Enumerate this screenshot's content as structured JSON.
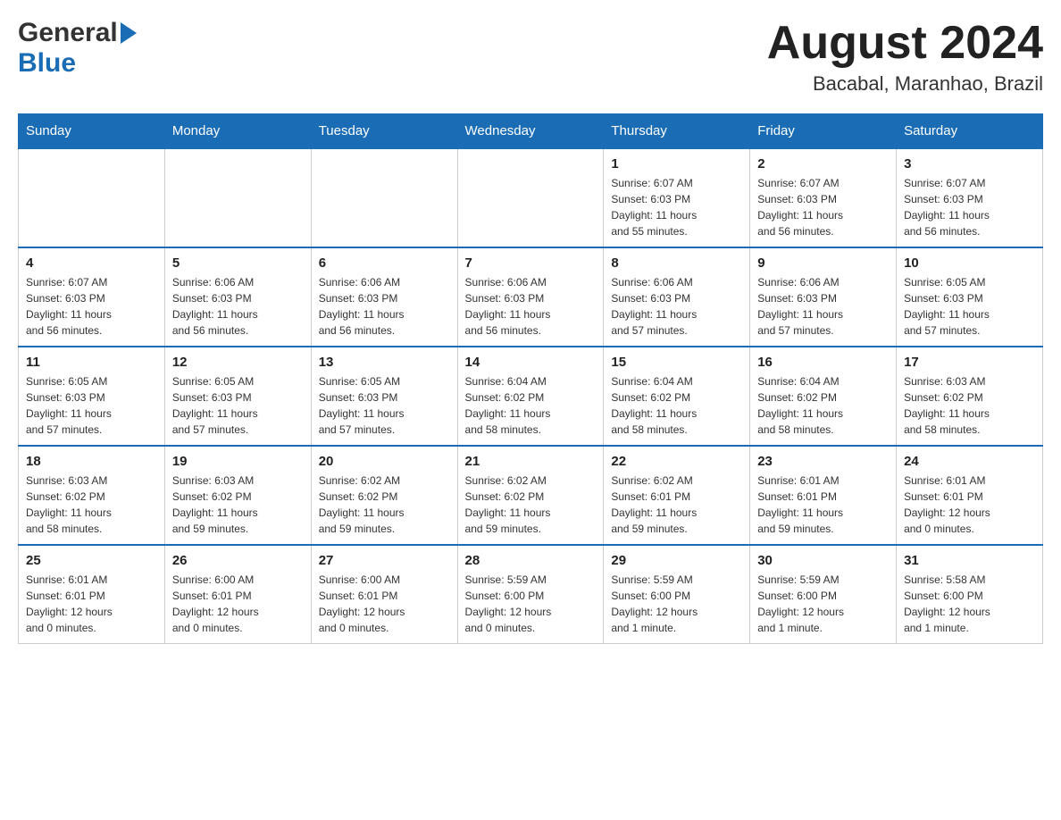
{
  "header": {
    "logo_general": "General",
    "logo_blue": "Blue",
    "month_title": "August 2024",
    "location": "Bacabal, Maranhao, Brazil"
  },
  "days_of_week": [
    "Sunday",
    "Monday",
    "Tuesday",
    "Wednesday",
    "Thursday",
    "Friday",
    "Saturday"
  ],
  "weeks": [
    [
      {
        "day": "",
        "info": ""
      },
      {
        "day": "",
        "info": ""
      },
      {
        "day": "",
        "info": ""
      },
      {
        "day": "",
        "info": ""
      },
      {
        "day": "1",
        "info": "Sunrise: 6:07 AM\nSunset: 6:03 PM\nDaylight: 11 hours\nand 55 minutes."
      },
      {
        "day": "2",
        "info": "Sunrise: 6:07 AM\nSunset: 6:03 PM\nDaylight: 11 hours\nand 56 minutes."
      },
      {
        "day": "3",
        "info": "Sunrise: 6:07 AM\nSunset: 6:03 PM\nDaylight: 11 hours\nand 56 minutes."
      }
    ],
    [
      {
        "day": "4",
        "info": "Sunrise: 6:07 AM\nSunset: 6:03 PM\nDaylight: 11 hours\nand 56 minutes."
      },
      {
        "day": "5",
        "info": "Sunrise: 6:06 AM\nSunset: 6:03 PM\nDaylight: 11 hours\nand 56 minutes."
      },
      {
        "day": "6",
        "info": "Sunrise: 6:06 AM\nSunset: 6:03 PM\nDaylight: 11 hours\nand 56 minutes."
      },
      {
        "day": "7",
        "info": "Sunrise: 6:06 AM\nSunset: 6:03 PM\nDaylight: 11 hours\nand 56 minutes."
      },
      {
        "day": "8",
        "info": "Sunrise: 6:06 AM\nSunset: 6:03 PM\nDaylight: 11 hours\nand 57 minutes."
      },
      {
        "day": "9",
        "info": "Sunrise: 6:06 AM\nSunset: 6:03 PM\nDaylight: 11 hours\nand 57 minutes."
      },
      {
        "day": "10",
        "info": "Sunrise: 6:05 AM\nSunset: 6:03 PM\nDaylight: 11 hours\nand 57 minutes."
      }
    ],
    [
      {
        "day": "11",
        "info": "Sunrise: 6:05 AM\nSunset: 6:03 PM\nDaylight: 11 hours\nand 57 minutes."
      },
      {
        "day": "12",
        "info": "Sunrise: 6:05 AM\nSunset: 6:03 PM\nDaylight: 11 hours\nand 57 minutes."
      },
      {
        "day": "13",
        "info": "Sunrise: 6:05 AM\nSunset: 6:03 PM\nDaylight: 11 hours\nand 57 minutes."
      },
      {
        "day": "14",
        "info": "Sunrise: 6:04 AM\nSunset: 6:02 PM\nDaylight: 11 hours\nand 58 minutes."
      },
      {
        "day": "15",
        "info": "Sunrise: 6:04 AM\nSunset: 6:02 PM\nDaylight: 11 hours\nand 58 minutes."
      },
      {
        "day": "16",
        "info": "Sunrise: 6:04 AM\nSunset: 6:02 PM\nDaylight: 11 hours\nand 58 minutes."
      },
      {
        "day": "17",
        "info": "Sunrise: 6:03 AM\nSunset: 6:02 PM\nDaylight: 11 hours\nand 58 minutes."
      }
    ],
    [
      {
        "day": "18",
        "info": "Sunrise: 6:03 AM\nSunset: 6:02 PM\nDaylight: 11 hours\nand 58 minutes."
      },
      {
        "day": "19",
        "info": "Sunrise: 6:03 AM\nSunset: 6:02 PM\nDaylight: 11 hours\nand 59 minutes."
      },
      {
        "day": "20",
        "info": "Sunrise: 6:02 AM\nSunset: 6:02 PM\nDaylight: 11 hours\nand 59 minutes."
      },
      {
        "day": "21",
        "info": "Sunrise: 6:02 AM\nSunset: 6:02 PM\nDaylight: 11 hours\nand 59 minutes."
      },
      {
        "day": "22",
        "info": "Sunrise: 6:02 AM\nSunset: 6:01 PM\nDaylight: 11 hours\nand 59 minutes."
      },
      {
        "day": "23",
        "info": "Sunrise: 6:01 AM\nSunset: 6:01 PM\nDaylight: 11 hours\nand 59 minutes."
      },
      {
        "day": "24",
        "info": "Sunrise: 6:01 AM\nSunset: 6:01 PM\nDaylight: 12 hours\nand 0 minutes."
      }
    ],
    [
      {
        "day": "25",
        "info": "Sunrise: 6:01 AM\nSunset: 6:01 PM\nDaylight: 12 hours\nand 0 minutes."
      },
      {
        "day": "26",
        "info": "Sunrise: 6:00 AM\nSunset: 6:01 PM\nDaylight: 12 hours\nand 0 minutes."
      },
      {
        "day": "27",
        "info": "Sunrise: 6:00 AM\nSunset: 6:01 PM\nDaylight: 12 hours\nand 0 minutes."
      },
      {
        "day": "28",
        "info": "Sunrise: 5:59 AM\nSunset: 6:00 PM\nDaylight: 12 hours\nand 0 minutes."
      },
      {
        "day": "29",
        "info": "Sunrise: 5:59 AM\nSunset: 6:00 PM\nDaylight: 12 hours\nand 1 minute."
      },
      {
        "day": "30",
        "info": "Sunrise: 5:59 AM\nSunset: 6:00 PM\nDaylight: 12 hours\nand 1 minute."
      },
      {
        "day": "31",
        "info": "Sunrise: 5:58 AM\nSunset: 6:00 PM\nDaylight: 12 hours\nand 1 minute."
      }
    ]
  ]
}
